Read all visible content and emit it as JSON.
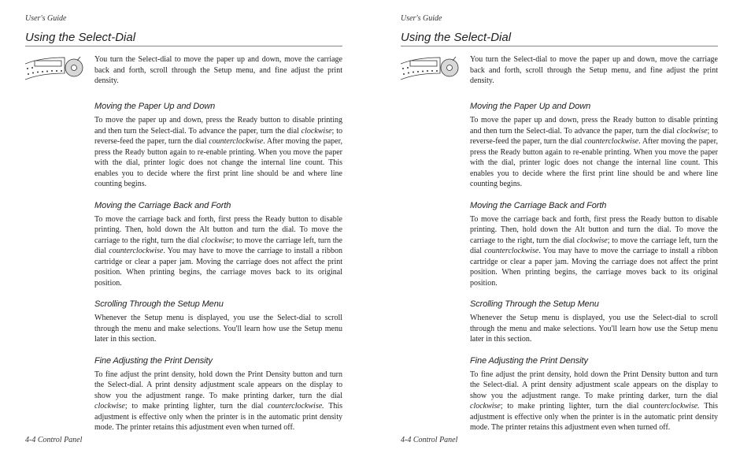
{
  "header": "User's Guide",
  "sectionTitle": "Using the Select-Dial",
  "intro": "You turn the Select-dial to move the paper up and down, move the carriage back and forth, scroll through the Setup menu, and fine adjust the print density.",
  "sub1": "Moving the Paper Up and Down",
  "p1a": "To move the paper up and down, press the Ready button to disable printing and then turn the Select-dial.  To advance the paper, turn the dial ",
  "p1b": "clockwise",
  "p1c": "; to reverse-feed the paper, turn the dial ",
  "p1d": "counterclockwise",
  "p1e": ".  After moving the paper, press the Ready button again to re-enable printing.  When you move the paper with the dial, printer logic does not change the internal line count.  This enables you to decide where the first print line should be and where line counting begins.",
  "sub2": "Moving the Carriage Back and Forth",
  "p2a": "To move the carriage back and forth, first press the Ready button to disable printing.  Then, hold down the Alt button and turn the dial.  To move the carriage to the right, turn the dial ",
  "p2b": "clockwise",
  "p2c": "; to move the carriage left,  turn the dial ",
  "p2d": "counterclockwise",
  "p2e": ".  You may have to move the carriage to install a ribbon cartridge or clear a paper jam.  Moving the carriage does not affect the print position.  When printing begins, the carriage moves back to its original position.",
  "sub3": "Scrolling Through the Setup Menu",
  "p3": "Whenever the Setup menu is displayed, you use the Select-dial to scroll through the menu and make selections.  You'll learn how use the Setup menu later in this section.",
  "sub4": "Fine Adjusting the Print Density",
  "p4a": "To fine adjust the print density, hold down the Print Density button and turn the Select-dial.  A print density adjustment scale appears on the display to show you the adjustment range.  To make printing darker, turn the dial ",
  "p4b": "clockwise",
  "p4c": "; to make printing lighter, turn the dial ",
  "p4d": "counterclockwise.",
  "p4e": "  This adjustment is effective only when the printer is in the automatic print density mode.  The printer retains this adjustment even when turned off.",
  "footer": "4-4 Control Panel"
}
